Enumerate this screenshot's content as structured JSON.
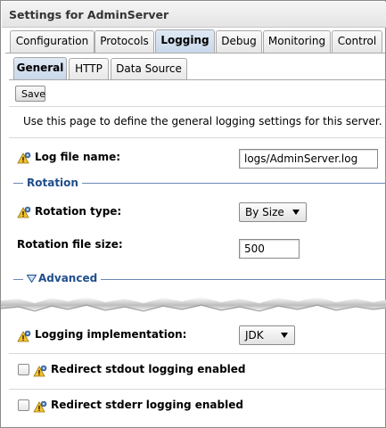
{
  "window": {
    "title": "Settings for AdminServer"
  },
  "tabs": [
    "Configuration",
    "Protocols",
    "Logging",
    "Debug",
    "Monitoring",
    "Control"
  ],
  "active_tab": "Logging",
  "subtabs": [
    "General",
    "HTTP",
    "Data Source"
  ],
  "active_subtab": "General",
  "toolbar": {
    "save_label": "Save"
  },
  "description": "Use this page to define the general logging settings for this server.",
  "log_file": {
    "label": "Log file name:",
    "value": "logs/AdminServer.log"
  },
  "rotation": {
    "section_title": "Rotation",
    "type_label": "Rotation type:",
    "type_value": "By Size",
    "size_label": "Rotation file size:",
    "size_value": "500"
  },
  "advanced": {
    "section_title": "Advanced",
    "expanded": true
  },
  "logging_impl": {
    "label": "Logging implementation:",
    "value": "JDK"
  },
  "redirect_stdout": {
    "label": "Redirect stdout logging enabled",
    "checked": false
  },
  "redirect_stderr": {
    "label": "Redirect stderr logging enabled",
    "checked": false
  },
  "icons": {
    "config_change": "restart-required-icon",
    "expand": "triangle-down-icon",
    "dropdown": "caret-down-icon"
  },
  "colors": {
    "section_title": "#1f4e8c",
    "section_line": "#6b87b5",
    "active_tab": "#c8d7ea"
  }
}
